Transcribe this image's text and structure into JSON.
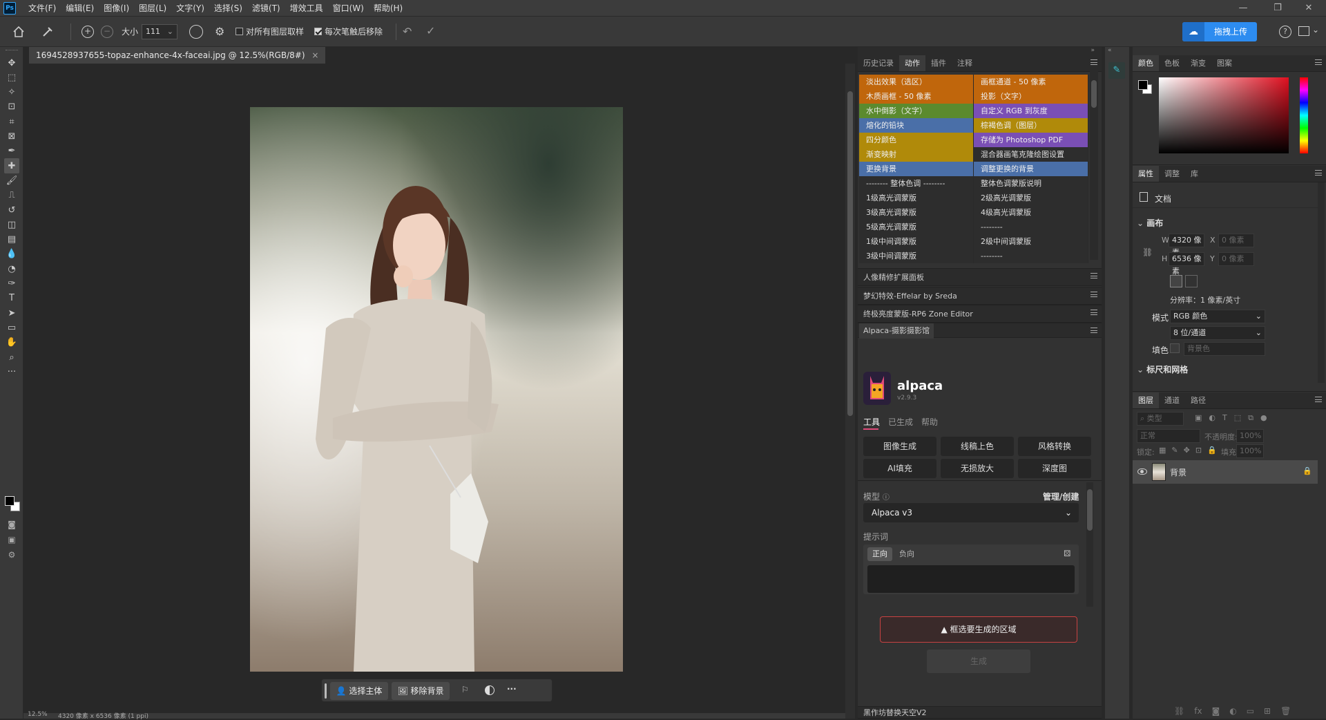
{
  "app": {
    "logo": "Ps"
  },
  "menubar": [
    "文件(F)",
    "编辑(E)",
    "图像(I)",
    "图层(L)",
    "文字(Y)",
    "选择(S)",
    "滤镜(T)",
    "增效工具",
    "窗口(W)",
    "帮助(H)"
  ],
  "options": {
    "size_label": "大小",
    "size_value": "111",
    "sample_all_layers": "对所有图层取样",
    "remove_after_stroke": "每次笔触后移除",
    "upload_label": "拖拽上传"
  },
  "document": {
    "tab_title": "1694528937655-topaz-enhance-4x-faceai.jpg @ 12.5%(RGB/8#)",
    "close": "×"
  },
  "status": {
    "zoom": "12.5%",
    "info": "4320 像素 x 6536 像素 (1 ppi)"
  },
  "contextbar": {
    "select_subject": "选择主体",
    "remove_bg": "移除背景",
    "more": "···"
  },
  "panel_tabs_a": [
    "历史记录",
    "动作",
    "插件",
    "注释"
  ],
  "actions": [
    [
      "淡出效果（选区）",
      "画框通道 - 50 像素"
    ],
    [
      "木质画框 - 50 像素",
      "投影（文字）"
    ],
    [
      "水中倒影（文字）",
      "自定义 RGB 到灰度"
    ],
    [
      "熔化的铅块",
      "棕褐色调（图层）"
    ],
    [
      "四分颜色",
      "存储为 Photoshop PDF"
    ],
    [
      "渐变映射",
      "混合器画笔克隆绘图设置"
    ],
    [
      "更换背景",
      "调整更换的背景"
    ],
    [
      "-------- 整体色调 --------",
      "整体色调蒙版说明"
    ],
    [
      "1级高光调蒙版",
      "2级高光调蒙版"
    ],
    [
      "3级高光调蒙版",
      "4级高光调蒙版"
    ],
    [
      "5级高光调蒙版",
      "--------"
    ],
    [
      "1级中间调蒙版",
      "2级中间调蒙版"
    ],
    [
      "3级中间调蒙版",
      "--------"
    ]
  ],
  "action_colors": [
    [
      "#c0660c",
      "#c0660c"
    ],
    [
      "#c0660c",
      "#c0660c"
    ],
    [
      "#5b8a2e",
      "#7a4fb5"
    ],
    [
      "#4a6fa8",
      "#b08a0a"
    ],
    [
      "#b08a0a",
      "#7a4fb5"
    ],
    [
      "#b08a0a",
      "#2d2d2d"
    ],
    [
      "#4a6fa8",
      "#4a6fa8"
    ],
    [
      "#2d2d2d",
      "#2d2d2d"
    ],
    [
      "#2d2d2d",
      "#2d2d2d"
    ],
    [
      "#2d2d2d",
      "#2d2d2d"
    ],
    [
      "#2d2d2d",
      "#2d2d2d"
    ],
    [
      "#2d2d2d",
      "#2d2d2d"
    ],
    [
      "#2d2d2d",
      "#2d2d2d"
    ]
  ],
  "collapsed_panels": [
    "人像精修扩展面板",
    "梦幻特效-Effelar by Sreda",
    "终极亮度蒙版-RP6 Zone Editor",
    "Alpaca-摄影摄影馆"
  ],
  "alpaca": {
    "name": "alpaca",
    "version": "v2.9.3",
    "tabs": [
      "工具",
      "已生成",
      "帮助"
    ],
    "buttons": [
      "图像生成",
      "线稿上色",
      "风格转换",
      "AI填充",
      "无损放大",
      "深度图"
    ],
    "model_label": "模型",
    "manage": "管理/创建",
    "model": "Alpaca v3",
    "prompt_label": "提示词",
    "pos": "正向",
    "neg": "负向",
    "warning": "框选要生成的区域",
    "generate": "生成"
  },
  "bottom_panel": "黑作坊替换天空V2",
  "panel_tabs_color": [
    "颜色",
    "色板",
    "渐变",
    "图案"
  ],
  "panel_tabs_props": [
    "属性",
    "调整",
    "库"
  ],
  "props": {
    "doc": "文档",
    "canvas": "画布",
    "w_label": "W",
    "w": "4320 像素",
    "h_label": "H",
    "h": "6536 像素",
    "x_label": "X",
    "x": "0 像素",
    "y_label": "Y",
    "y": "0 像素",
    "resolution": "分辨率：1 像素/英寸",
    "mode_label": "模式",
    "mode": "RGB 颜色",
    "depth": "8 位/通道",
    "fill_label": "填色",
    "fill": "背景色",
    "rulers": "标尺和网格"
  },
  "panel_tabs_layers": [
    "图层",
    "通道",
    "路径"
  ],
  "layers": {
    "search": "类型",
    "blend": "正常",
    "opacity_label": "不透明度:",
    "opacity": "100%",
    "lock_label": "锁定:",
    "fill_label": "填充:",
    "fill": "100%",
    "layer_name": "背景"
  }
}
